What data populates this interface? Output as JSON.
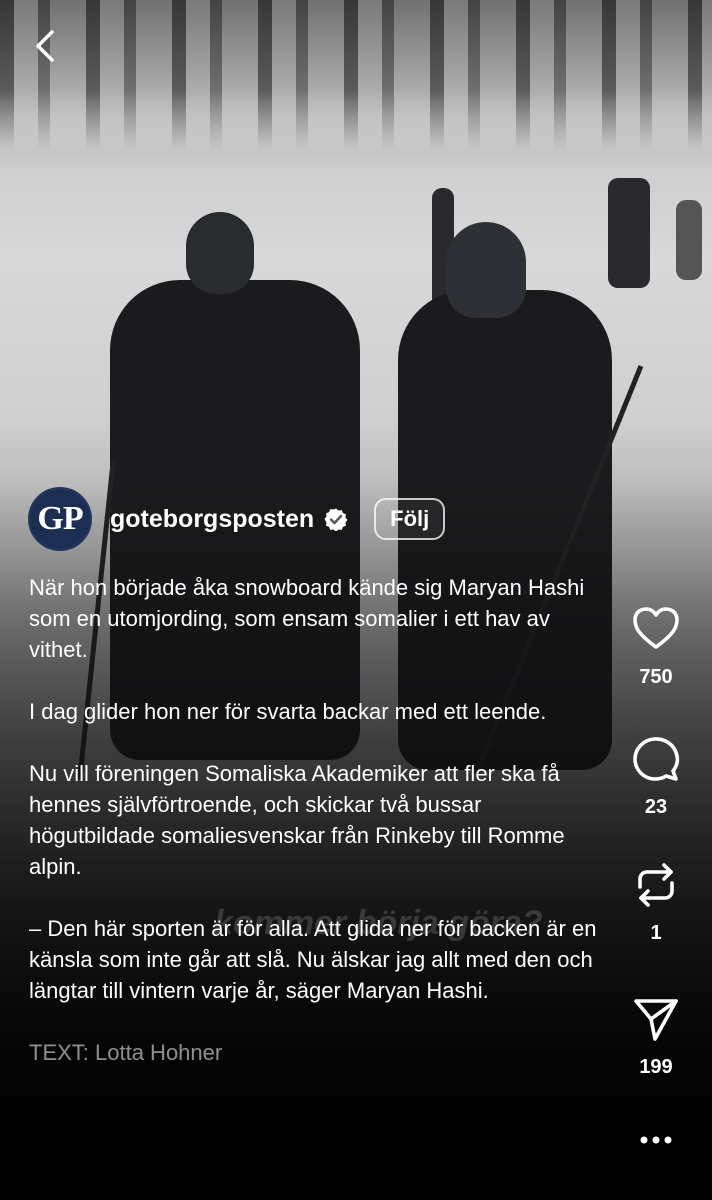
{
  "account": {
    "avatar_text": "GP",
    "username": "goteborgsposten",
    "follow_label": "Följ"
  },
  "caption": {
    "paragraphs": [
      "När hon började åka snowboard kände sig Maryan Hashi som en utomjording, som ensam somalier i ett hav av vithet.",
      "I dag glider hon ner för svarta backar med ett leende.",
      "Nu vill föreningen Somaliska Akademiker att fler ska få hennes självförtroende, och skickar två bussar högutbildade somaliesvenskar från Rinkeby till Romme alpin.",
      "– Den här sporten är för alla. Att glida ner för backen är en känsla som inte går att slå. Nu älskar jag allt med den och längtar till vintern varje år, säger Maryan Hashi."
    ],
    "credit": "TEXT: Lotta Hohner"
  },
  "video_overlay_text": "kommer börja göra?",
  "actions": {
    "likes": "750",
    "comments": "23",
    "reposts": "1",
    "shares": "199"
  },
  "icons": {
    "back": "chevron-left-icon",
    "verified": "verified-badge-icon",
    "like": "heart-icon",
    "comment": "comment-bubble-icon",
    "repost": "repost-icon",
    "share": "paper-plane-icon",
    "more": "more-dots-icon"
  },
  "colors": {
    "avatar_bg": "#1c2f52",
    "text": "#ffffff"
  }
}
